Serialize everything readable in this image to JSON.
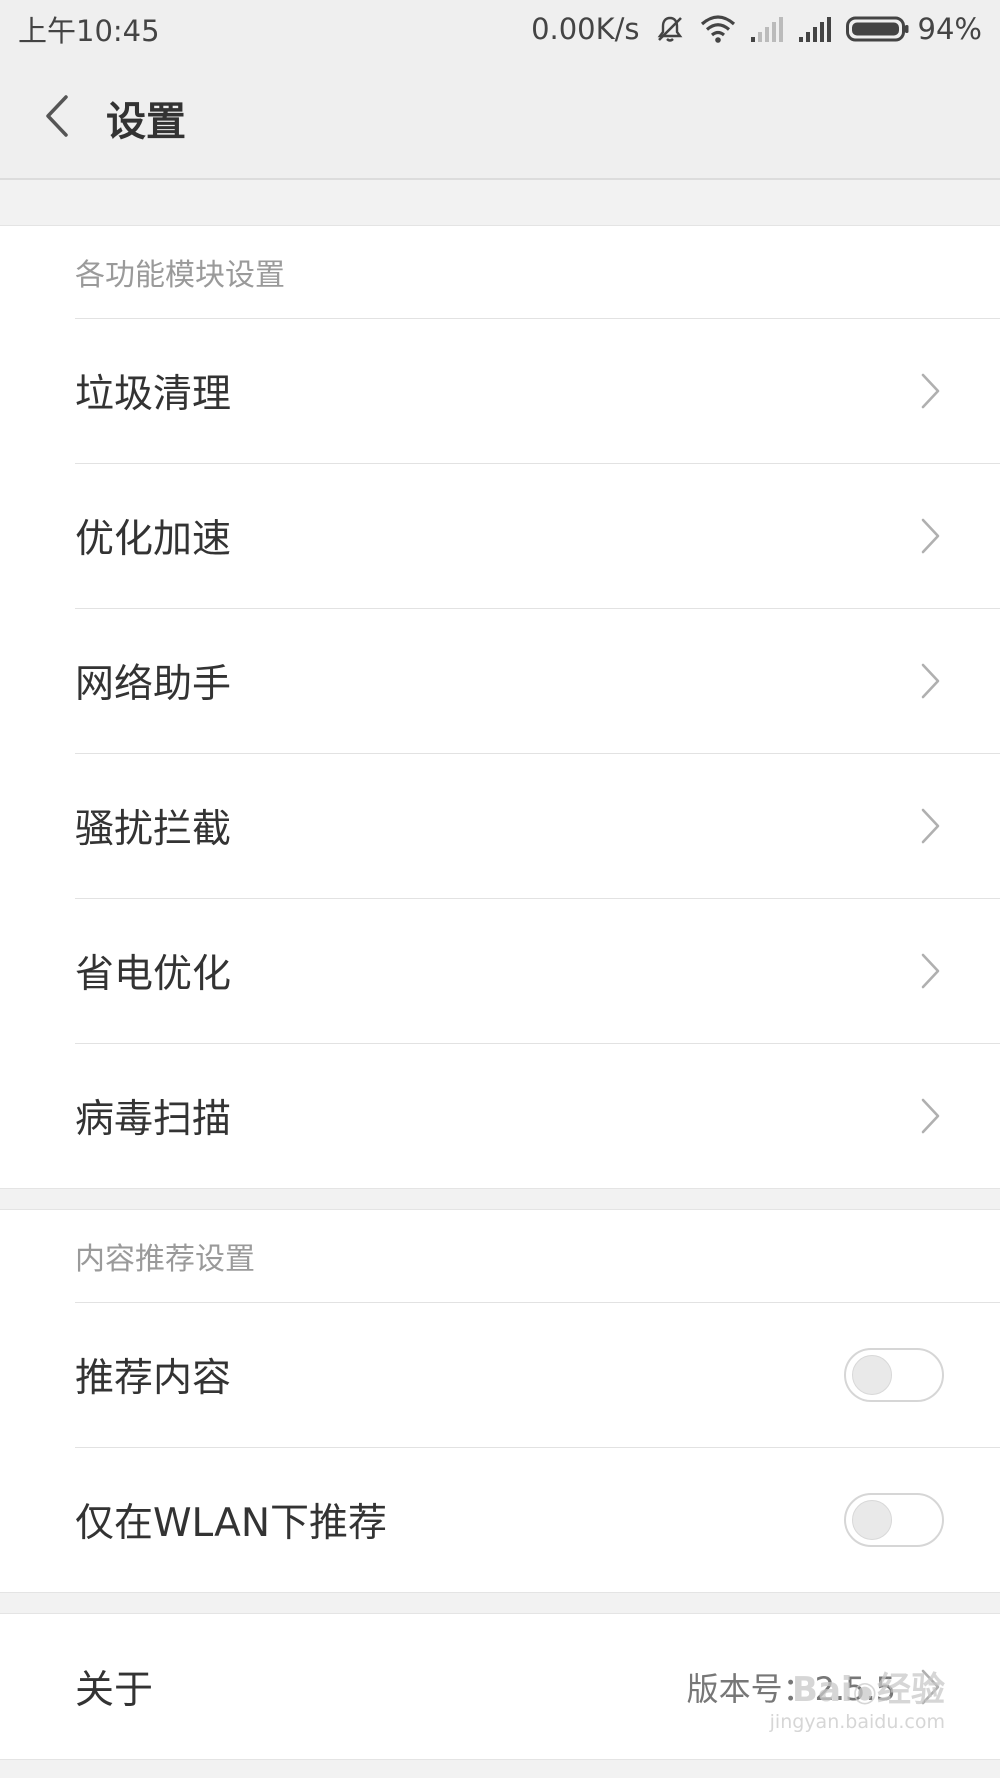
{
  "status_bar": {
    "time": "上午10:45",
    "network_speed": "0.00K/s",
    "battery_percent": "94%",
    "icons": [
      "mute-icon",
      "wifi-icon",
      "signal-icon-1",
      "signal-icon-2",
      "battery-icon"
    ]
  },
  "header": {
    "title": "设置"
  },
  "modules_section": {
    "header": "各功能模块设置",
    "items": [
      {
        "label": "垃圾清理"
      },
      {
        "label": "优化加速"
      },
      {
        "label": "网络助手"
      },
      {
        "label": "骚扰拦截"
      },
      {
        "label": "省电优化"
      },
      {
        "label": "病毒扫描"
      }
    ]
  },
  "content_section": {
    "header": "内容推荐设置",
    "items": [
      {
        "label": "推荐内容",
        "toggle_on": false
      },
      {
        "label": "仅在WLAN下推荐",
        "toggle_on": false
      }
    ]
  },
  "about_section": {
    "label": "关于",
    "version": "版本号：2.5.5"
  },
  "colors": {
    "background": "#f2f2f2",
    "card": "#ffffff",
    "text_primary": "#333333",
    "text_secondary": "#9a9a9a",
    "divider": "#e2e2e2"
  }
}
